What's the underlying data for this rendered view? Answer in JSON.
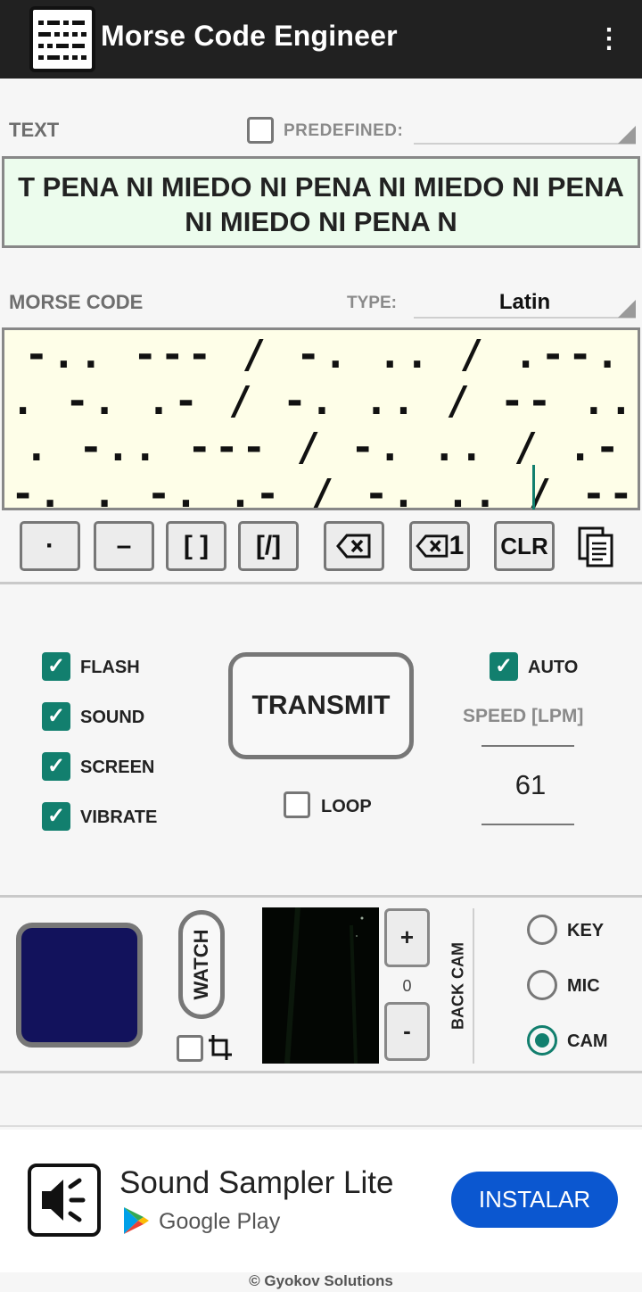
{
  "app": {
    "title": "Morse Code Engineer",
    "menu_icon": "more-vert-icon"
  },
  "text_section": {
    "label": "TEXT",
    "predefined_label": "PREDEFINED:",
    "predefined_checked": false,
    "text": "T PENA NI MIEDO NI PENA NI MIEDO NI PENA NI MIEDO NI PENA N"
  },
  "morse_section": {
    "label": "MORSE CODE",
    "type_label": "TYPE:",
    "type_value": "Latin",
    "code": "-.. --- / -. .. / .--. . -. .- / -. .. / -- .. . -.. --- / -. .. / .--. . -. .- / -. .. / -- .. . -.. --- / -. .. / .--. . -. .- / -."
  },
  "keypad": {
    "dot": "·",
    "dash": "–",
    "space": "[ ]",
    "slash": "[/]",
    "backspace_icon": "backspace-icon",
    "backspace1_label": "1",
    "clear": "CLR",
    "copy_icon": "copy-icon"
  },
  "options": {
    "flash": {
      "label": "FLASH",
      "checked": true
    },
    "sound": {
      "label": "SOUND",
      "checked": true
    },
    "screen": {
      "label": "SCREEN",
      "checked": true
    },
    "vibrate": {
      "label": "VIBRATE",
      "checked": true
    },
    "transmit": "TRANSMIT",
    "loop": {
      "label": "LOOP",
      "checked": false
    },
    "auto": {
      "label": "AUTO",
      "checked": true
    },
    "speed_label": "SPEED [LPM]",
    "speed_value": "61"
  },
  "receiver": {
    "color_swatch": "#12125c",
    "watch_label": "WATCH",
    "crop_checked": false,
    "crop_icon": "crop-icon",
    "zoom_plus": "+",
    "zoom_value": "0",
    "zoom_minus": "-",
    "camera_label": "BACK CAM",
    "modes": [
      {
        "label": "KEY",
        "selected": false
      },
      {
        "label": "MIC",
        "selected": false
      },
      {
        "label": "CAM",
        "selected": true
      }
    ]
  },
  "ad": {
    "title": "Sound Sampler Lite",
    "store": "Google Play",
    "install": "INSTALAR",
    "icon": "speaker-icon"
  },
  "footer": "© Gyokov Solutions",
  "colors": {
    "accent": "#127f6e",
    "topbar": "#212121",
    "install": "#0b57d0"
  }
}
